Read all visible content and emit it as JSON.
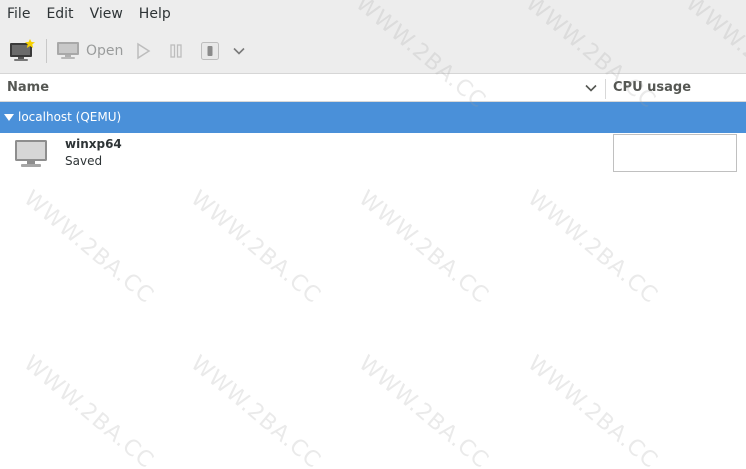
{
  "menubar": {
    "items": [
      "File",
      "Edit",
      "View",
      "Help"
    ]
  },
  "toolbar": {
    "new_icon": "new-vm-icon",
    "open_label": "Open",
    "open_icon": "monitor-icon",
    "run_icon": "play-icon",
    "pause_icon": "pause-icon",
    "shutdown_icon": "shutdown-icon",
    "menu_icon": "chevron-down-icon"
  },
  "columns": {
    "name": "Name",
    "cpu": "CPU usage"
  },
  "connection": {
    "label": "localhost (QEMU)"
  },
  "vms": [
    {
      "name": "winxp64",
      "status": "Saved",
      "icon": "monitor-icon"
    }
  ],
  "watermark": "WWW.2BA.CC",
  "colors": {
    "selection": "#4a90d9",
    "toolbar_bg": "#ededed",
    "text": "#2e3436"
  }
}
